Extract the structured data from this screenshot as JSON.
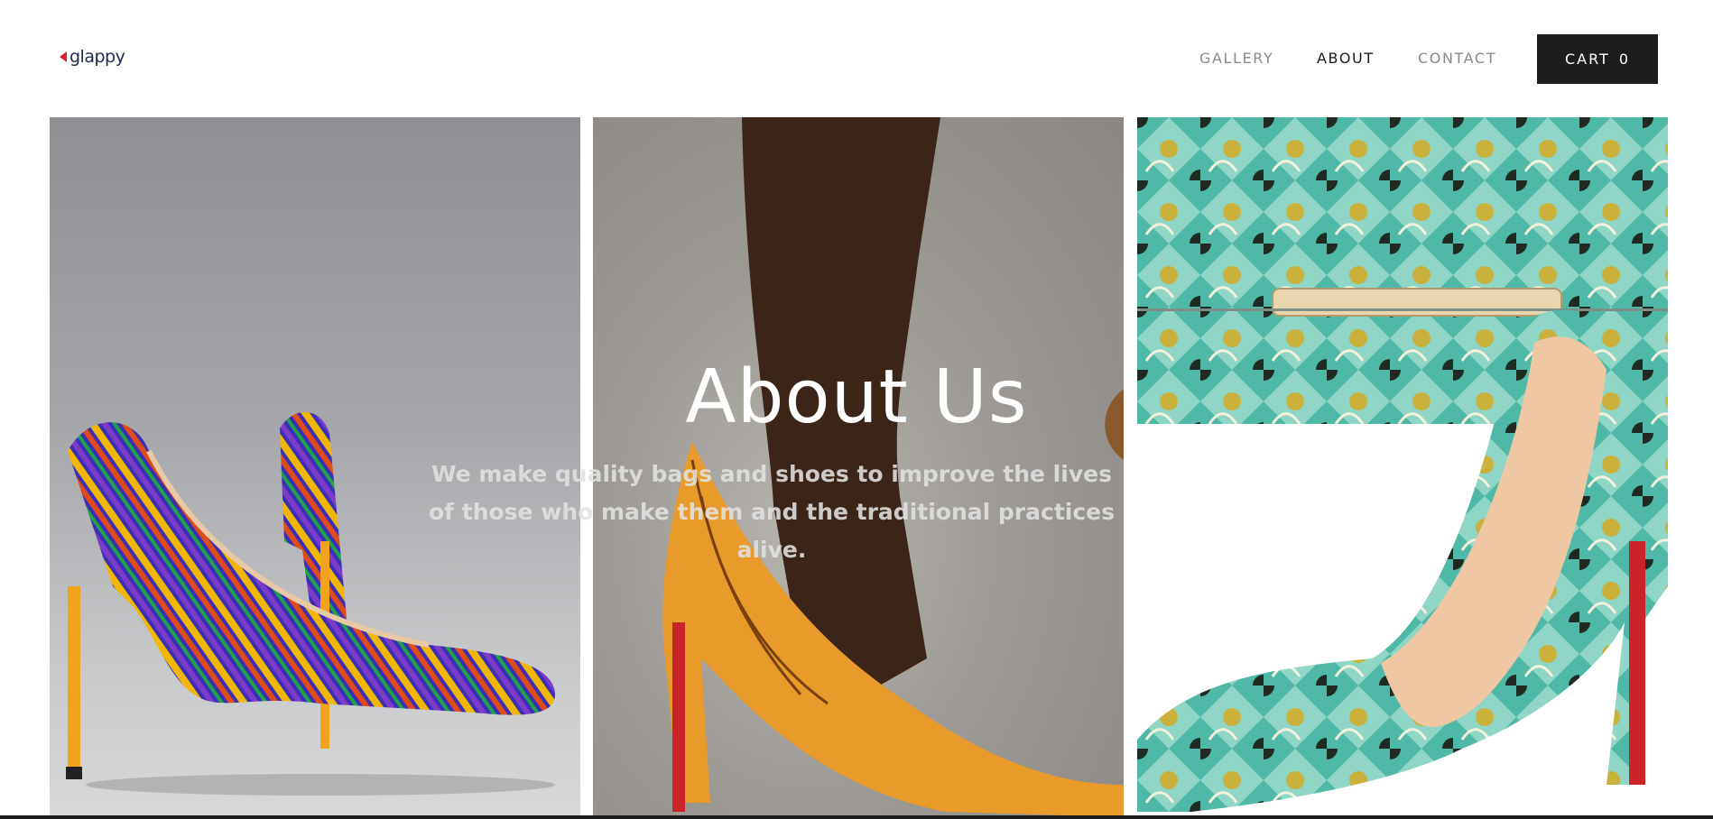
{
  "brand": {
    "name": "glappy",
    "accent": "#d6262f",
    "text_color": "#1c2b4a"
  },
  "nav": {
    "gallery": "GALLERY",
    "about": "ABOUT",
    "contact": "CONTACT",
    "cart_label": "CART",
    "cart_count": "0"
  },
  "hero": {
    "title": "About Us",
    "subtitle": "We make quality bags and shoes to improve the lives  of those who make them and the traditional practices alive."
  },
  "colors": {
    "cart_bg": "#1c1d1f",
    "nav_inactive": "#8a8a8a",
    "nav_active": "#1a1a1a"
  }
}
